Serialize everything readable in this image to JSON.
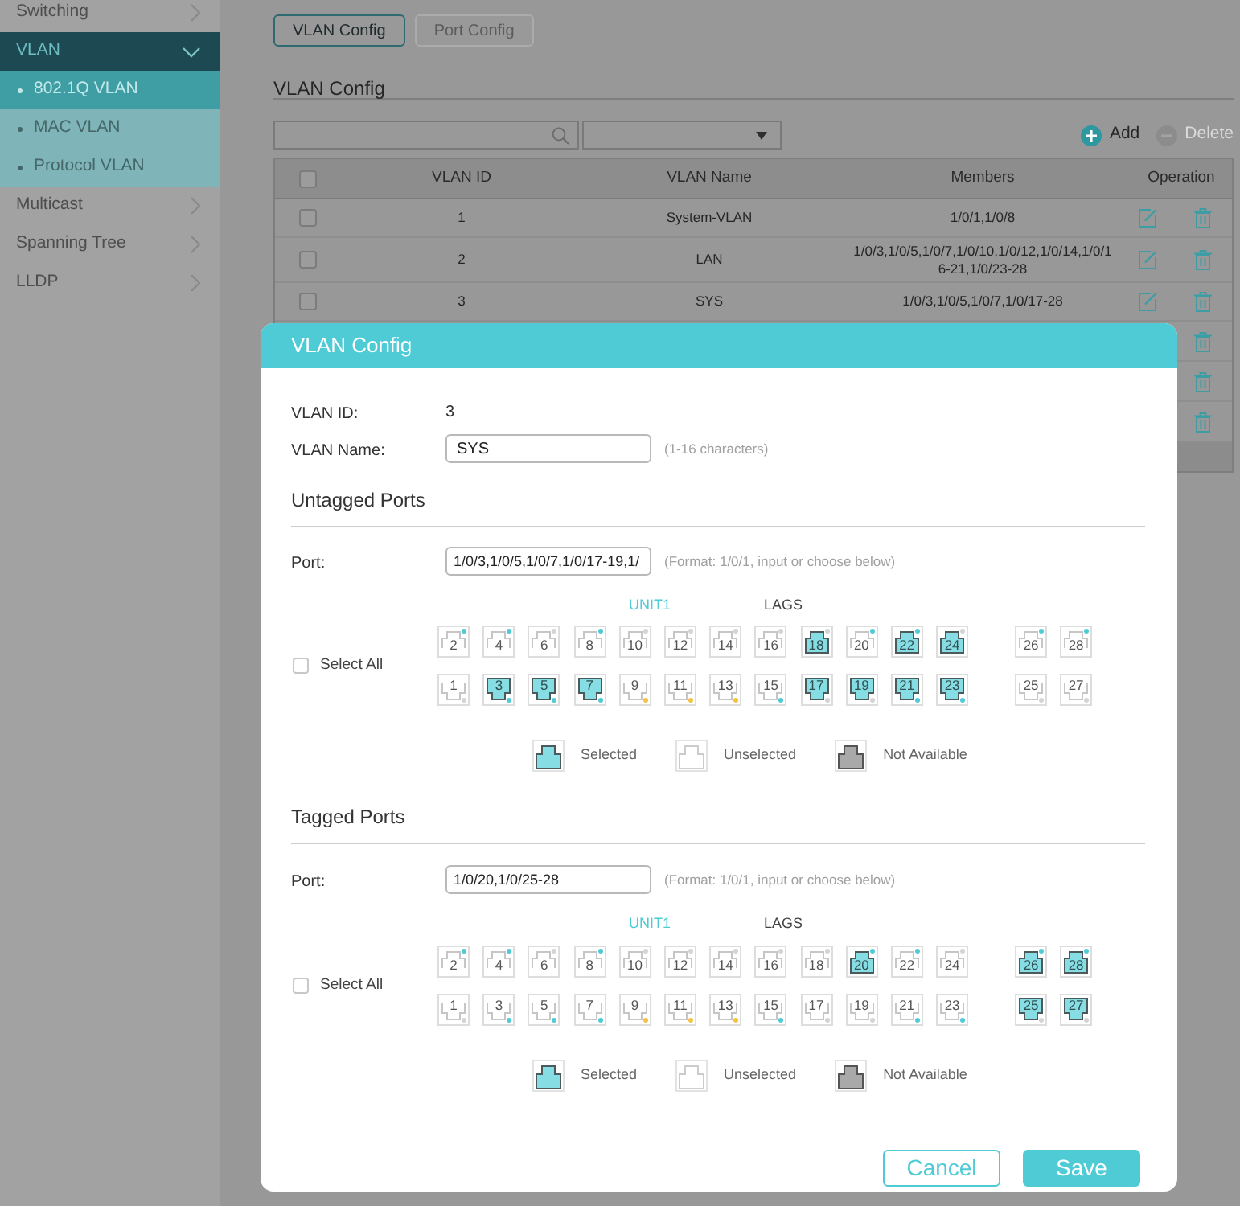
{
  "sidebar": {
    "items": [
      {
        "label": "Switching",
        "selected": false,
        "expanded": false
      },
      {
        "label": "VLAN",
        "selected": true,
        "expanded": true,
        "children": [
          {
            "label": "802.1Q VLAN",
            "selected": true
          },
          {
            "label": "MAC VLAN",
            "selected": false
          },
          {
            "label": "Protocol VLAN",
            "selected": false
          }
        ]
      },
      {
        "label": "Multicast",
        "selected": false,
        "expanded": false
      },
      {
        "label": "Spanning Tree",
        "selected": false,
        "expanded": false
      },
      {
        "label": "LLDP",
        "selected": false,
        "expanded": false
      }
    ]
  },
  "tabs": [
    {
      "label": "VLAN Config",
      "selected": true
    },
    {
      "label": "Port Config",
      "selected": false
    }
  ],
  "heading": "VLAN Config",
  "toolbar": [
    {
      "kind": "add",
      "label": "Add",
      "disabled": false
    },
    {
      "kind": "delete",
      "label": "Delete",
      "disabled": true
    }
  ],
  "table": {
    "header_checked": false,
    "columns": [
      "VLAN ID",
      "VLAN Name",
      "Members",
      "Operation"
    ],
    "rows": [
      {
        "kind": "full",
        "checked": false,
        "cells": [
          "1",
          "System-VLAN",
          "1/0/1,1/0/8"
        ]
      },
      {
        "kind": "full",
        "checked": false,
        "cells": [
          "2",
          "LAN",
          "1/0/3,1/0/5,1/0/7,1/0/10,1/0/12,1/0/14,1/0/16-21,1/0/23-28"
        ]
      },
      {
        "kind": "full",
        "checked": false,
        "cells": [
          "3",
          "SYS",
          "1/0/3,1/0/5,1/0/7,1/0/17-28"
        ]
      },
      {
        "kind": "covered"
      },
      {
        "kind": "covered"
      },
      {
        "kind": "covered"
      }
    ]
  },
  "dialog": {
    "title": "VLAN Config",
    "fields": [
      {
        "kind": "text",
        "label": "VLAN ID:",
        "value": "3"
      },
      {
        "kind": "input",
        "label": "VLAN Name:",
        "value": "SYS",
        "hint": "(1-16 characters)"
      }
    ],
    "sections": [
      {
        "title": "Untagged Ports",
        "port_label": "Port:",
        "port_value": "1/0/3,1/0/5,1/0/7,1/0/17-19,1/",
        "port_hint": "(Format: 1/0/1, input or choose below)",
        "groups": [
          {
            "label": "UNIT1",
            "selected": true
          },
          {
            "label": "LAGS",
            "selected": false
          }
        ],
        "select_all": {
          "label": "Select All",
          "checked": false
        },
        "port_rows": [
          {
            "main": [
              {
                "label": "2",
                "selected": false,
                "color": "#4ecbd5"
              },
              {
                "label": "4",
                "selected": false,
                "color": "#4ecbd5"
              },
              {
                "label": "6",
                "selected": false,
                "color": "#d4d4d4"
              },
              {
                "label": "8",
                "selected": false,
                "color": "#4ecbd5"
              },
              {
                "label": "10",
                "selected": false,
                "color": "#d4d4d4"
              },
              {
                "label": "12",
                "selected": false,
                "color": "#d4d4d4"
              },
              {
                "label": "14",
                "selected": false,
                "color": "#d4d4d4"
              },
              {
                "label": "16",
                "selected": false,
                "color": "#d4d4d4"
              },
              {
                "label": "18",
                "selected": true,
                "color": "#d4d4d4"
              },
              {
                "label": "20",
                "selected": false,
                "color": "#4ecbd5"
              },
              {
                "label": "22",
                "selected": true,
                "color": "#4ecbd5"
              },
              {
                "label": "24",
                "selected": true,
                "color": "#d4d4d4"
              }
            ],
            "side": [
              {
                "label": "26",
                "selected": false,
                "color": "#4ecbd5"
              },
              {
                "label": "28",
                "selected": false,
                "color": "#4ecbd5"
              }
            ]
          },
          {
            "main": [
              {
                "label": "1",
                "selected": false,
                "color": "#d4d4d4"
              },
              {
                "label": "3",
                "selected": true,
                "color": "#4ecbd5"
              },
              {
                "label": "5",
                "selected": true,
                "color": "#4ecbd5"
              },
              {
                "label": "7",
                "selected": true,
                "color": "#4ecbd5"
              },
              {
                "label": "9",
                "selected": false,
                "color": "#f5c342"
              },
              {
                "label": "11",
                "selected": false,
                "color": "#f5c342"
              },
              {
                "label": "13",
                "selected": false,
                "color": "#f5c342"
              },
              {
                "label": "15",
                "selected": false,
                "color": "#4ecbd5"
              },
              {
                "label": "17",
                "selected": true,
                "color": "#d4d4d4"
              },
              {
                "label": "19",
                "selected": true,
                "color": "#d4d4d4"
              },
              {
                "label": "21",
                "selected": true,
                "color": "#4ecbd5"
              },
              {
                "label": "23",
                "selected": true,
                "color": "#4ecbd5"
              }
            ],
            "side": [
              {
                "label": "25",
                "selected": false,
                "color": "#d4d4d4"
              },
              {
                "label": "27",
                "selected": false,
                "color": "#d4d4d4"
              }
            ]
          }
        ],
        "legend": [
          {
            "kind": "selected",
            "label": "Selected"
          },
          {
            "kind": "unselected",
            "label": "Unselected"
          },
          {
            "kind": "unavailable",
            "label": "Not Available"
          }
        ]
      },
      {
        "title": "Tagged Ports",
        "port_label": "Port:",
        "port_value": "1/0/20,1/0/25-28",
        "port_hint": "(Format: 1/0/1, input or choose below)",
        "groups": [
          {
            "label": "UNIT1",
            "selected": true
          },
          {
            "label": "LAGS",
            "selected": false
          }
        ],
        "select_all": {
          "label": "Select All",
          "checked": false
        },
        "port_rows": [
          {
            "main": [
              {
                "label": "2",
                "selected": false,
                "color": "#4ecbd5"
              },
              {
                "label": "4",
                "selected": false,
                "color": "#4ecbd5"
              },
              {
                "label": "6",
                "selected": false,
                "color": "#d4d4d4"
              },
              {
                "label": "8",
                "selected": false,
                "color": "#4ecbd5"
              },
              {
                "label": "10",
                "selected": false,
                "color": "#d4d4d4"
              },
              {
                "label": "12",
                "selected": false,
                "color": "#d4d4d4"
              },
              {
                "label": "14",
                "selected": false,
                "color": "#d4d4d4"
              },
              {
                "label": "16",
                "selected": false,
                "color": "#d4d4d4"
              },
              {
                "label": "18",
                "selected": false,
                "color": "#d4d4d4"
              },
              {
                "label": "20",
                "selected": true,
                "color": "#4ecbd5"
              },
              {
                "label": "22",
                "selected": false,
                "color": "#4ecbd5"
              },
              {
                "label": "24",
                "selected": false,
                "color": "#d4d4d4"
              }
            ],
            "side": [
              {
                "label": "26",
                "selected": true,
                "color": "#4ecbd5"
              },
              {
                "label": "28",
                "selected": true,
                "color": "#4ecbd5"
              }
            ]
          },
          {
            "main": [
              {
                "label": "1",
                "selected": false,
                "color": "#d4d4d4"
              },
              {
                "label": "3",
                "selected": false,
                "color": "#4ecbd5"
              },
              {
                "label": "5",
                "selected": false,
                "color": "#4ecbd5"
              },
              {
                "label": "7",
                "selected": false,
                "color": "#4ecbd5"
              },
              {
                "label": "9",
                "selected": false,
                "color": "#f5c342"
              },
              {
                "label": "11",
                "selected": false,
                "color": "#f5c342"
              },
              {
                "label": "13",
                "selected": false,
                "color": "#f5c342"
              },
              {
                "label": "15",
                "selected": false,
                "color": "#4ecbd5"
              },
              {
                "label": "17",
                "selected": false,
                "color": "#d4d4d4"
              },
              {
                "label": "19",
                "selected": false,
                "color": "#d4d4d4"
              },
              {
                "label": "21",
                "selected": false,
                "color": "#4ecbd5"
              },
              {
                "label": "23",
                "selected": false,
                "color": "#4ecbd5"
              }
            ],
            "side": [
              {
                "label": "25",
                "selected": true,
                "color": "#d4d4d4"
              },
              {
                "label": "27",
                "selected": true,
                "color": "#d4d4d4"
              }
            ]
          }
        ],
        "legend": [
          {
            "kind": "selected",
            "label": "Selected"
          },
          {
            "kind": "unselected",
            "label": "Unselected"
          },
          {
            "kind": "unavailable",
            "label": "Not Available"
          }
        ]
      }
    ],
    "buttons": [
      {
        "kind": "secondary",
        "label": "Cancel"
      },
      {
        "kind": "primary",
        "label": "Save"
      }
    ]
  }
}
